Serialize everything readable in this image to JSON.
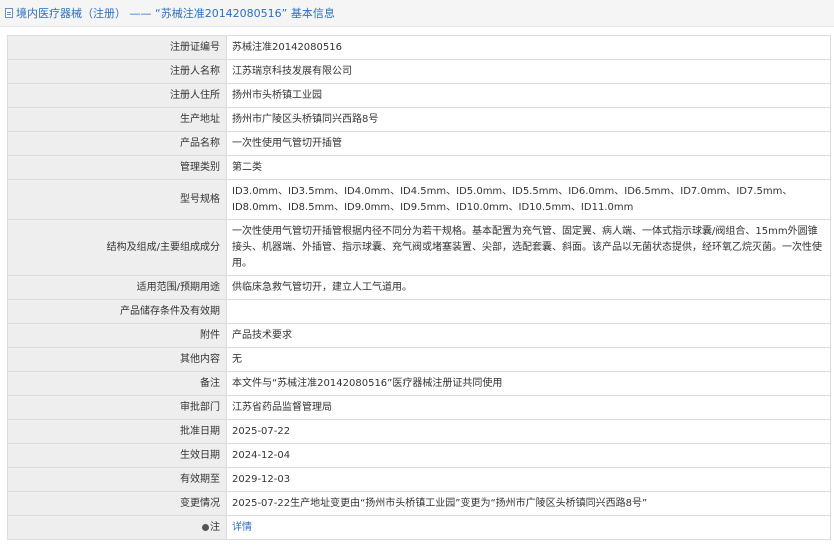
{
  "header": {
    "title": "境内医疗器械（注册） —— “苏械注准20142080516” 基本信息",
    "icon": "document-icon"
  },
  "rows": [
    {
      "label": "注册证编号",
      "value": "苏械注准20142080516"
    },
    {
      "label": "注册人名称",
      "value": "江苏瑞京科技发展有限公司"
    },
    {
      "label": "注册人住所",
      "value": "扬州市头桥镇工业园"
    },
    {
      "label": "生产地址",
      "value": "扬州市广陵区头桥镇同兴西路8号"
    },
    {
      "label": "产品名称",
      "value": "一次性使用气管切开插管"
    },
    {
      "label": "管理类别",
      "value": "第二类"
    },
    {
      "label": "型号规格",
      "value": "ID3.0mm、ID3.5mm、ID4.0mm、ID4.5mm、ID5.0mm、ID5.5mm、ID6.0mm、ID6.5mm、ID7.0mm、ID7.5mm、ID8.0mm、ID8.5mm、ID9.0mm、ID9.5mm、ID10.0mm、ID10.5mm、ID11.0mm"
    },
    {
      "label": "结构及组成/主要组成成分",
      "value": "一次性使用气管切开插管根据内径不同分为若干规格。基本配置为充气管、固定翼、病人端、一体式指示球囊/阀组合、15mm外圆锥接头、机器端、外插管、指示球囊、充气阀或堵塞装置、尖部，选配套囊、斜面。该产品以无菌状态提供，经环氧乙烷灭菌。一次性使用。"
    },
    {
      "label": "适用范围/预期用途",
      "value": "供临床急救气管切开，建立人工气道用。"
    },
    {
      "label": "产品储存条件及有效期",
      "value": ""
    },
    {
      "label": "附件",
      "value": "产品技术要求"
    },
    {
      "label": "其他内容",
      "value": "无"
    },
    {
      "label": "备注",
      "value": "本文件与“苏械注准20142080516”医疗器械注册证共同使用"
    },
    {
      "label": "审批部门",
      "value": "江苏省药品监督管理局"
    },
    {
      "label": "批准日期",
      "value": "2025-07-22"
    },
    {
      "label": "生效日期",
      "value": "2024-12-04"
    },
    {
      "label": "有效期至",
      "value": "2029-12-03"
    },
    {
      "label": "变更情况",
      "value": "2025-07-22生产地址变更由“扬州市头桥镇工业园”变更为“扬州市广陵区头桥镇同兴西路8号”"
    }
  ],
  "note_row": {
    "label": "注",
    "link": "详情"
  }
}
